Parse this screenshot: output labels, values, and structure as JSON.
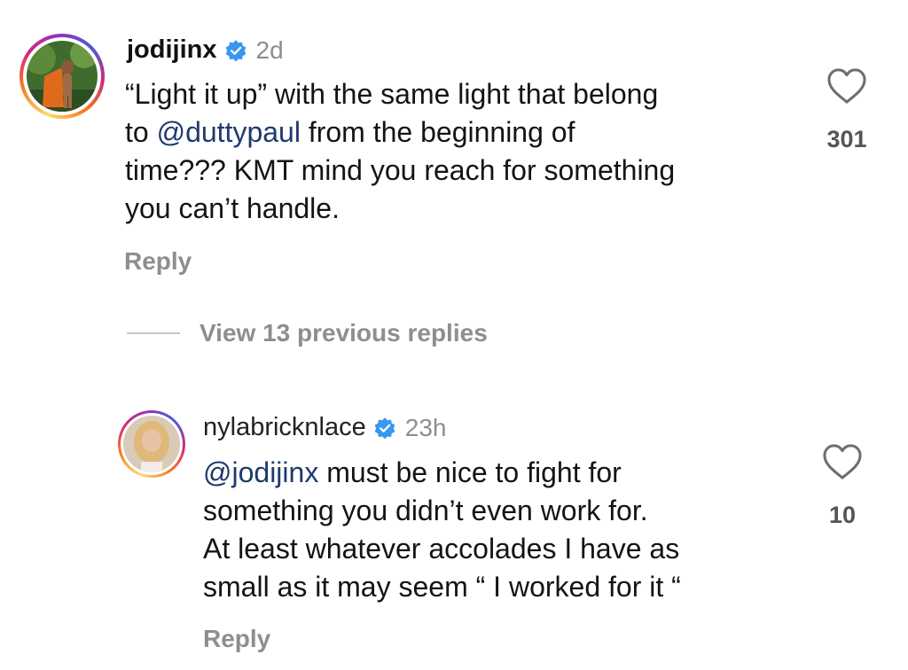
{
  "comments": [
    {
      "username": "jodijinx",
      "time": "2d",
      "lines": [
        {
          "pre": "“Light it up” with the same light that belong",
          "mention": "",
          "post": ""
        },
        {
          "pre": "to ",
          "mention": "@duttypaul",
          "post": " from the beginning of"
        },
        {
          "pre": "time??? KMT mind you reach for something",
          "mention": "",
          "post": ""
        },
        {
          "pre": "you can’t handle.",
          "mention": "",
          "post": ""
        }
      ],
      "reply_label": "Reply",
      "likes": "301"
    },
    {
      "username": "nylabricknlace",
      "time": "23h",
      "lines": [
        {
          "pre": "",
          "mention": "@jodijinx",
          "post": " must be nice to fight for"
        },
        {
          "pre": "something you didn’t even work for.",
          "mention": "",
          "post": ""
        },
        {
          "pre": "At least whatever accolades I have as",
          "mention": "",
          "post": ""
        },
        {
          "pre": "small as it may seem “ I worked for it “",
          "mention": "",
          "post": ""
        }
      ],
      "reply_label": "Reply",
      "likes": "10"
    }
  ],
  "view_replies_label": "View 13 previous replies",
  "icons": {
    "verified": "verified-badge-icon",
    "like": "heart-outline-icon"
  },
  "colors": {
    "verified": "#3897f0",
    "mention": "#1e3a6e",
    "muted": "#8e8e8e"
  }
}
